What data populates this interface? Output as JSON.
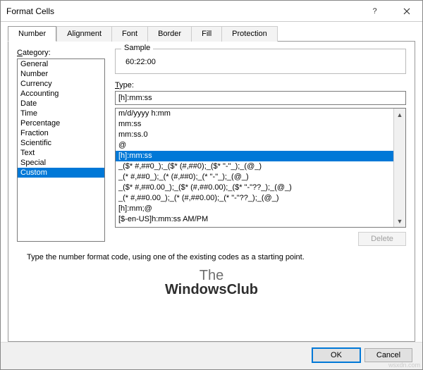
{
  "window": {
    "title": "Format Cells"
  },
  "tabs": [
    "Number",
    "Alignment",
    "Font",
    "Border",
    "Fill",
    "Protection"
  ],
  "active_tab": "Number",
  "category": {
    "label": "Category:",
    "items": [
      "General",
      "Number",
      "Currency",
      "Accounting",
      "Date",
      "Time",
      "Percentage",
      "Fraction",
      "Scientific",
      "Text",
      "Special",
      "Custom"
    ],
    "selected": "Custom"
  },
  "sample": {
    "label": "Sample",
    "value": "60:22:00"
  },
  "type": {
    "label": "Type:",
    "value": "[h]:mm:ss",
    "items": [
      "m/d/yyyy h:mm",
      "mm:ss",
      "mm:ss.0",
      "@",
      "[h]:mm:ss",
      "_($* #,##0_);_($* (#,##0);_($* \"-\"_);_(@_)",
      "_(* #,##0_);_(* (#,##0);_(* \"-\"_);_(@_)",
      "_($* #,##0.00_);_($* (#,##0.00);_($* \"-\"??_);_(@_)",
      "_(* #,##0.00_);_(* (#,##0.00);_(* \"-\"??_);_(@_)",
      "[h]:mm;@",
      "[$-en-US]h:mm:ss AM/PM"
    ],
    "selected": "[h]:mm:ss"
  },
  "buttons": {
    "delete": "Delete",
    "ok": "OK",
    "cancel": "Cancel"
  },
  "hint": "Type the number format code, using one of the existing codes as a starting point.",
  "watermark": {
    "line1": "The",
    "line2": "WindowsClub"
  },
  "source": "wsxdn.com"
}
